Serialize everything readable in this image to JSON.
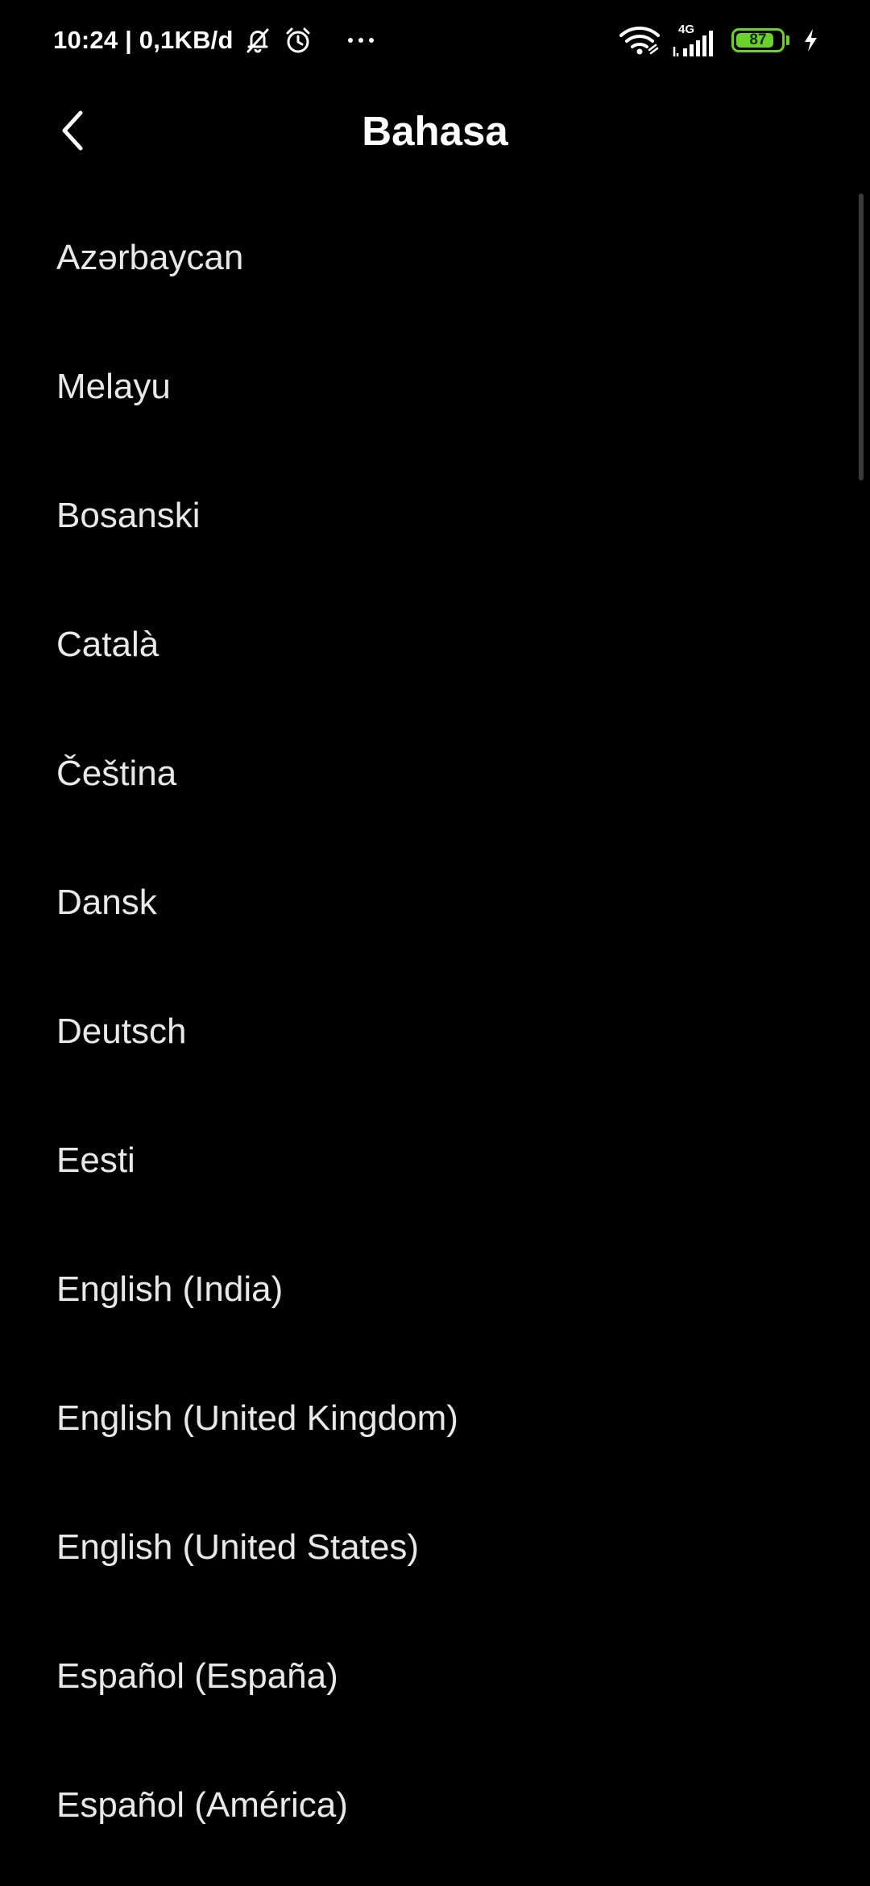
{
  "status_bar": {
    "time_and_speed": "10:24 | 0,1KB/d",
    "network_type": "4G",
    "battery_level": "87",
    "battery_fraction": 0.87,
    "icons": [
      "notifications-off-icon",
      "alarm-icon",
      "more-icon",
      "wifi-icon",
      "signal-icon",
      "battery-icon",
      "charging-icon"
    ]
  },
  "header": {
    "title": "Bahasa",
    "back_icon": "chevron-left-icon"
  },
  "languages": [
    "Azərbaycan",
    "Melayu",
    "Bosanski",
    "Català",
    "Čeština",
    "Dansk",
    "Deutsch",
    "Eesti",
    "English (India)",
    "English (United Kingdom)",
    "English (United States)",
    "Español (España)",
    "Español (América)"
  ],
  "colors": {
    "background": "#000000",
    "text": "#ffffff",
    "battery": "#6bd12b"
  }
}
